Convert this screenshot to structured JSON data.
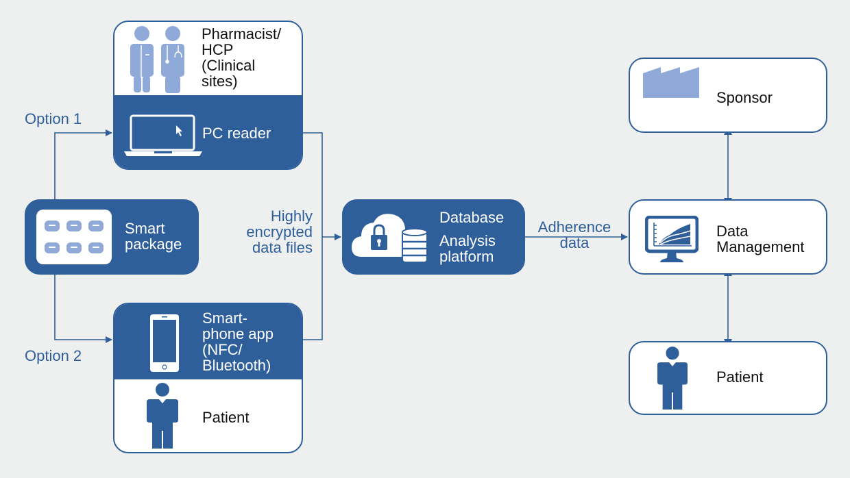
{
  "colors": {
    "primary": "#2f5f9a",
    "icon_light": "#8fa9d9",
    "background": "#eeefef"
  },
  "nodes": {
    "hcp": {
      "title_lines": [
        "Pharmacist/",
        "HCP",
        "(Clinical",
        "sites)"
      ],
      "icon": "doctor-pharmacist-icon"
    },
    "pc_reader": {
      "title": "PC reader",
      "icon": "laptop-icon"
    },
    "smart_package": {
      "title_lines": [
        "Smart",
        "package"
      ],
      "icon": "blister-pack-icon"
    },
    "smartphone": {
      "title_lines": [
        "Smart-",
        "phone app",
        "(NFC/",
        "Bluetooth)"
      ],
      "icon": "smartphone-icon"
    },
    "patient_left": {
      "title": "Patient",
      "icon": "person-icon"
    },
    "database": {
      "title_line1": "Database",
      "title_lines2": [
        "Analysis",
        "platform"
      ],
      "icon": "cloud-lock-database-icon"
    },
    "sponsor": {
      "title": "Sponsor",
      "icon": "factory-icon"
    },
    "data_management": {
      "title_lines": [
        "Data",
        "Management"
      ],
      "icon": "monitor-chart-icon"
    },
    "patient_right": {
      "title": "Patient",
      "icon": "person-icon"
    }
  },
  "labels": {
    "option1": "Option 1",
    "option2": "Option 2",
    "encrypted": [
      "Highly",
      "encrypted",
      "data files"
    ],
    "adherence": [
      "Adherence",
      "data"
    ]
  }
}
